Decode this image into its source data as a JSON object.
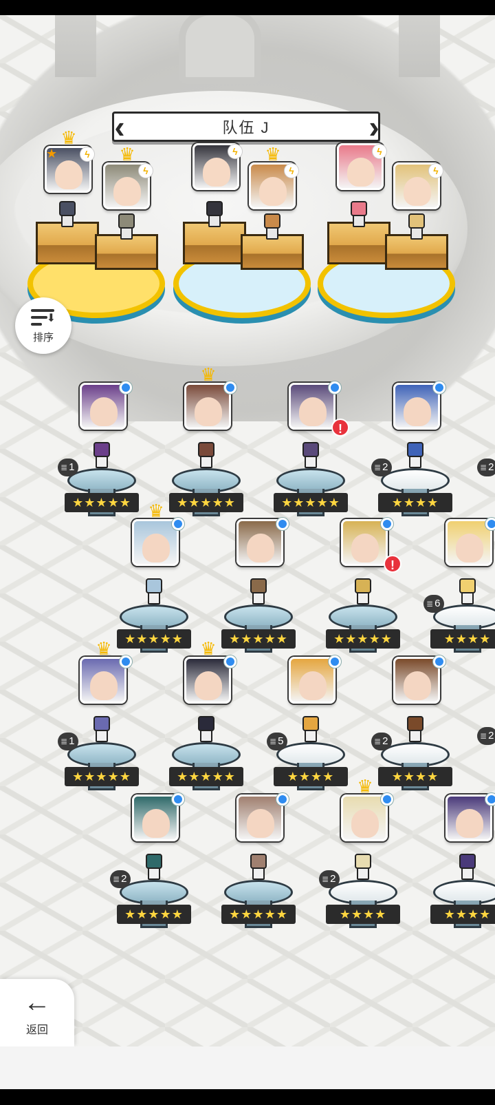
{
  "title": "队伍 J",
  "sort_button": {
    "label": "排序",
    "icon": "sort-icon"
  },
  "back_button": {
    "label": "返回",
    "icon": "back-arrow-icon"
  },
  "team_heroes": [
    {
      "slot": 1,
      "crown": true,
      "tag": "star",
      "bolt": true,
      "color": "#4a5063"
    },
    {
      "slot": 2,
      "crown": true,
      "bolt": true,
      "color": "#8d8a78"
    },
    {
      "slot": 3,
      "crown": false,
      "bolt": true,
      "color": "#34343c"
    },
    {
      "slot": 4,
      "crown": true,
      "bolt": true,
      "color": "#c98a4a"
    },
    {
      "slot": 5,
      "crown": false,
      "bolt": true,
      "color": "#e97a8a"
    },
    {
      "slot": 6,
      "crown": false,
      "bolt": true,
      "color": "#e2c27a"
    }
  ],
  "roster": [
    {
      "row": 1,
      "col": 1,
      "stars": "★★★★★",
      "count": "1",
      "crown": false,
      "alert": false,
      "color": "#6b3f8a"
    },
    {
      "row": 1,
      "col": 2,
      "stars": "★★★★★",
      "count": "",
      "crown": true,
      "alert": false,
      "color": "#7a4a3a"
    },
    {
      "row": 1,
      "col": 3,
      "stars": "★★★★★",
      "count": "",
      "crown": false,
      "alert": true,
      "color": "#5a4a7a"
    },
    {
      "row": 1,
      "col": 4,
      "stars": "★★★★",
      "count": "2",
      "crown": false,
      "alert": false,
      "color": "#3f63b8"
    },
    {
      "row": 2,
      "col": 1,
      "stars": "★★★★★",
      "count": "",
      "crown": true,
      "alert": false,
      "color": "#a9c6dc"
    },
    {
      "row": 2,
      "col": 2,
      "stars": "★★★★★",
      "count": "",
      "crown": false,
      "alert": false,
      "color": "#8a6a4a"
    },
    {
      "row": 2,
      "col": 3,
      "stars": "★★★★★",
      "count": "",
      "crown": false,
      "alert": true,
      "color": "#d7b255"
    },
    {
      "row": 2,
      "col": 4,
      "stars": "★★★★",
      "count": "6",
      "crown": false,
      "alert": false,
      "color": "#f0d070"
    },
    {
      "row": 3,
      "col": 1,
      "stars": "★★★★★",
      "count": "1",
      "crown": true,
      "alert": false,
      "color": "#6a6ab0"
    },
    {
      "row": 3,
      "col": 2,
      "stars": "★★★★★",
      "count": "",
      "crown": true,
      "alert": false,
      "color": "#2a2a3a"
    },
    {
      "row": 3,
      "col": 3,
      "stars": "★★★★",
      "count": "5",
      "crown": false,
      "alert": false,
      "color": "#e5a640"
    },
    {
      "row": 3,
      "col": 4,
      "stars": "★★★★",
      "count": "2",
      "crown": false,
      "alert": false,
      "color": "#7a4a2a"
    },
    {
      "row": 4,
      "col": 1,
      "stars": "★★★★★",
      "count": "2",
      "crown": false,
      "alert": false,
      "color": "#2f6a6a"
    },
    {
      "row": 4,
      "col": 2,
      "stars": "★★★★★",
      "count": "",
      "crown": false,
      "alert": false,
      "color": "#a08070"
    },
    {
      "row": 4,
      "col": 3,
      "stars": "★★★★",
      "count": "2",
      "crown": true,
      "alert": false,
      "color": "#e8dcb0"
    },
    {
      "row": 4,
      "col": 4,
      "stars": "★★★★",
      "count": "",
      "crown": false,
      "alert": false,
      "color": "#4a3a7a"
    }
  ],
  "edge_counts": [
    "2",
    "2"
  ]
}
